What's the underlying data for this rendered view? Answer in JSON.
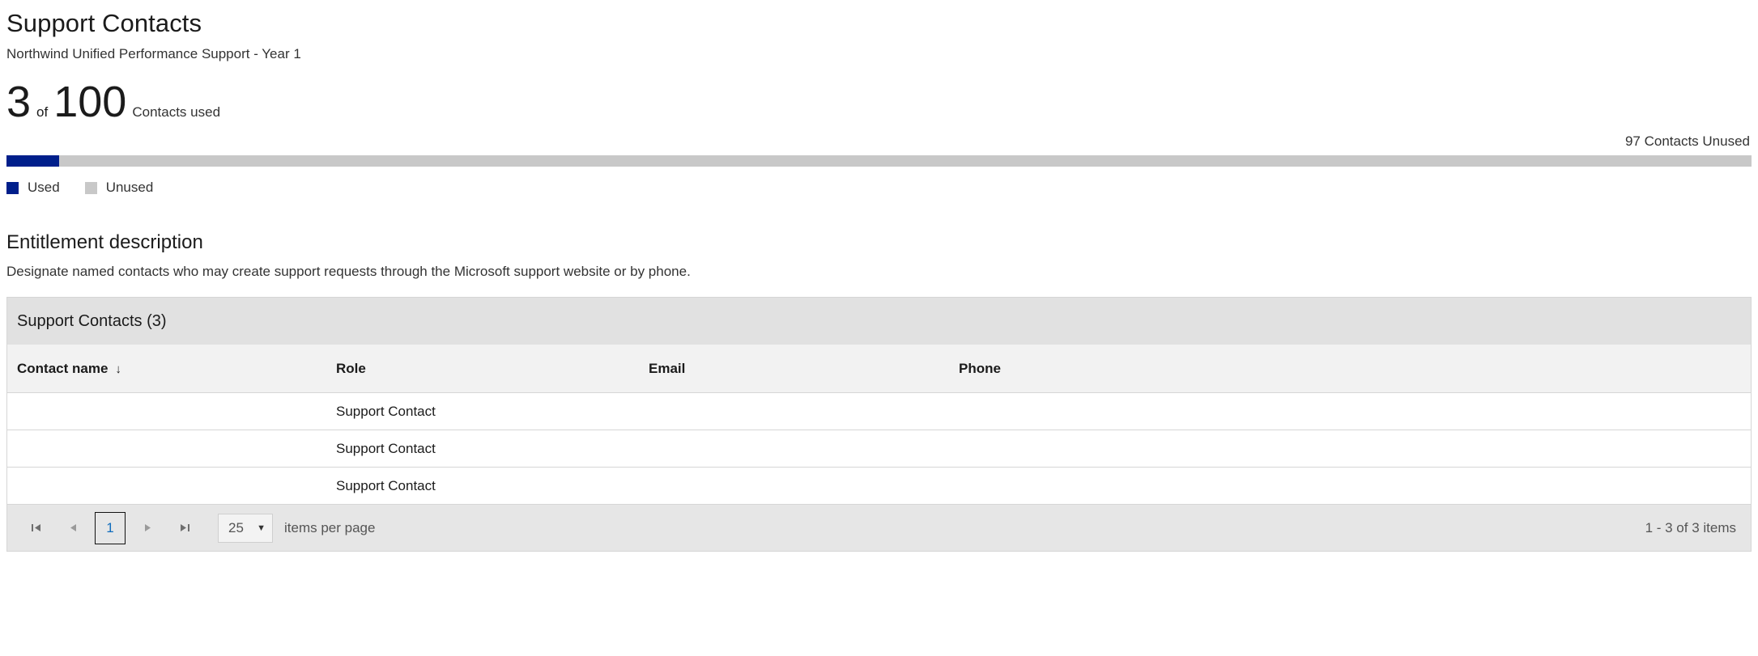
{
  "header": {
    "title": "Support Contacts",
    "subtitle": "Northwind Unified Performance Support - Year 1"
  },
  "usage": {
    "used": "3",
    "of_label": "of",
    "total": "100",
    "unit_label": "Contacts used",
    "unused_note": "97 Contacts Unused",
    "percent_used": 3,
    "colors": {
      "used": "#001f8b",
      "unused": "#c8c8c8"
    },
    "legend": [
      {
        "label": "Used",
        "color": "#001f8b",
        "swatch_icon": "square-swatch-icon"
      },
      {
        "label": "Unused",
        "color": "#c8c8c8",
        "swatch_icon": "square-swatch-icon"
      }
    ]
  },
  "entitlement": {
    "title": "Entitlement description",
    "description": "Designate named contacts who may create support requests through the Microsoft support website or by phone."
  },
  "grid": {
    "toolbar_title": "Support Contacts (3)",
    "columns": [
      {
        "label": "Contact name",
        "sorted": true,
        "sort_icon": "arrow-down-icon",
        "sort_glyph": "↓"
      },
      {
        "label": "Role",
        "sorted": false
      },
      {
        "label": "Email",
        "sorted": false
      },
      {
        "label": "Phone",
        "sorted": false
      }
    ],
    "rows": [
      {
        "contact_name": "",
        "role": "Support Contact",
        "email": "",
        "phone": ""
      },
      {
        "contact_name": "",
        "role": "Support Contact",
        "email": "",
        "phone": ""
      },
      {
        "contact_name": "",
        "role": "Support Contact",
        "email": "",
        "phone": ""
      }
    ]
  },
  "pager": {
    "first_icon": "❘◀",
    "first_glyph": "⏮",
    "prev_glyph": "◀",
    "current_page": "1",
    "next_glyph": "▶",
    "last_glyph": "⏭",
    "page_size": "25",
    "caret_glyph": "▼",
    "items_per_page_label": "items per page",
    "range_label": "1 - 3 of 3 items"
  }
}
